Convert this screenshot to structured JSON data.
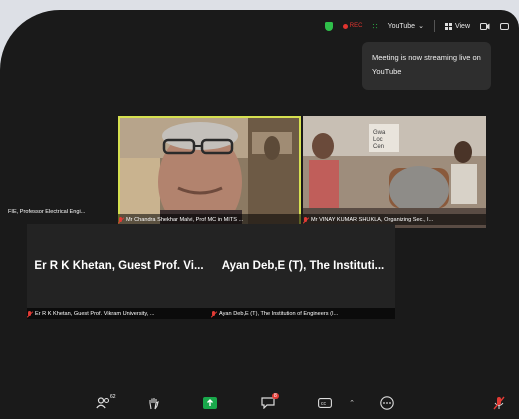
{
  "topbar": {
    "rec_label": "REC",
    "youtube_label": "YouTube",
    "view_label": "View"
  },
  "toast": {
    "message": "Meeting is now streaming live on YouTube"
  },
  "participants": [
    {
      "label": "FIE, Professor Electrical Engi...",
      "muted": true
    },
    {
      "label": "Mr Chandra Shekhar Malvi, Prof MC in MITS ...",
      "muted": true,
      "active_speaker": true
    },
    {
      "label": "Mr VINAY KUMAR SHUKLA, Organizing Sec., I...",
      "muted": true
    },
    {
      "label": "Er R K Khetan, Guest Prof. Vikram University, ...",
      "display_name": "Er R K Khetan, Guest Prof. Vi...",
      "muted": true
    },
    {
      "label": "Ayan Deb,E (T), The Institution of Engineers (I...",
      "display_name": "Ayan Deb,E (T), The Instituti...",
      "muted": true
    }
  ],
  "video_text": {
    "poster_line1": "Gwa",
    "poster_line2": "Loc",
    "poster_line3": "Cen"
  },
  "toolbar": {
    "participants_count": "62",
    "chat_badge": "8"
  },
  "colors": {
    "accent_speaker": "#d6e050",
    "mute_red": "#e23b35",
    "share_green": "#19a84b"
  }
}
